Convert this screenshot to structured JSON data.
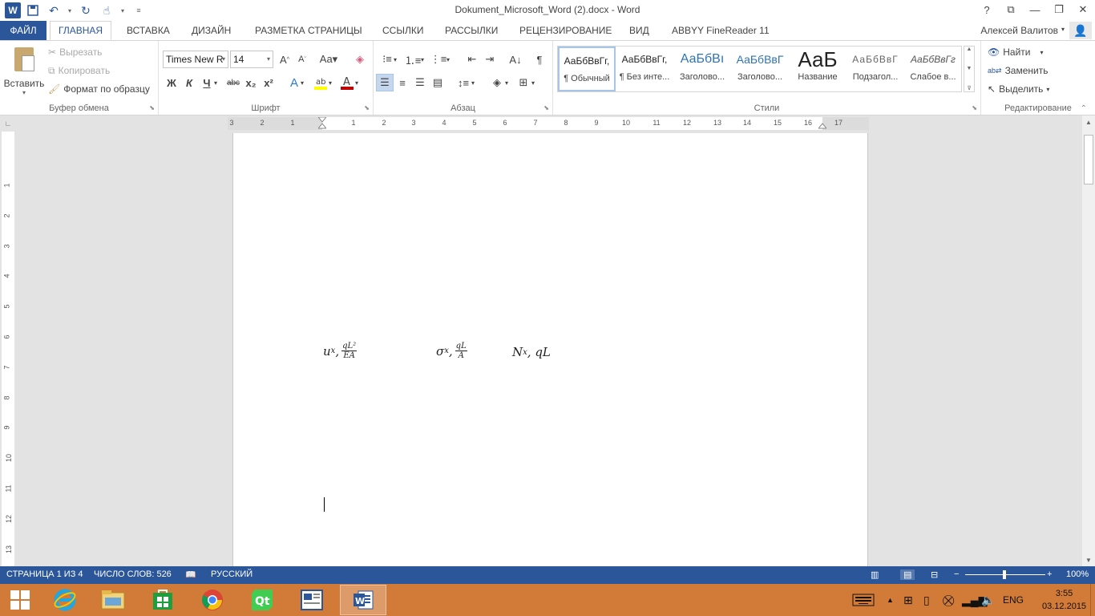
{
  "window": {
    "title": "Dokument_Microsoft_Word (2).docx - Word",
    "controls": [
      "?",
      "⧉",
      "—",
      "❐",
      "✕"
    ]
  },
  "tabs": {
    "file": "ФАЙЛ",
    "items": [
      "ГЛАВНАЯ",
      "ВСТАВКА",
      "ДИЗАЙН",
      "РАЗМЕТКА СТРАНИЦЫ",
      "ССЫЛКИ",
      "РАССЫЛКИ",
      "РЕЦЕНЗИРОВАНИЕ",
      "ВИД",
      "ABBYY FineReader 11"
    ],
    "active": "ГЛАВНАЯ"
  },
  "user": {
    "name": "Алексей Валитов"
  },
  "clipboard": {
    "label": "Буфер обмена",
    "paste": "Вставить",
    "cut": "Вырезать",
    "copy": "Копировать",
    "format_painter": "Формат по образцу"
  },
  "font": {
    "label": "Шрифт",
    "name": "Times New R",
    "size": "14",
    "buttons": [
      "Ж",
      "К",
      "Ч",
      "abc",
      "x₂",
      "x²"
    ]
  },
  "paragraph": {
    "label": "Абзац"
  },
  "styles": {
    "label": "Стили",
    "items": [
      {
        "sample": "АаБбВвГг,",
        "name": "¶ Обычный"
      },
      {
        "sample": "АаБбВвГг,",
        "name": "¶ Без инте..."
      },
      {
        "sample": "АаБбВı",
        "name": "Заголово..."
      },
      {
        "sample": "АаБбВвГ",
        "name": "Заголово..."
      },
      {
        "sample": "АаБ",
        "name": "Название"
      },
      {
        "sample": "АаБбВвГ",
        "name": "Подзагол..."
      },
      {
        "sample": "АаБбВвГг",
        "name": "Слабое в..."
      }
    ]
  },
  "editing": {
    "label": "Редактирование",
    "find": "Найти",
    "replace": "Заменить",
    "select": "Выделить"
  },
  "ruler": {
    "h_numbers": [
      "3",
      "2",
      "1",
      "1",
      "2",
      "3",
      "4",
      "5",
      "6",
      "7",
      "8",
      "9",
      "10",
      "11",
      "12",
      "13",
      "14",
      "15",
      "16",
      "17"
    ],
    "v_numbers": [
      "1",
      "2",
      "3",
      "4",
      "5",
      "6",
      "7",
      "8",
      "9",
      "10",
      "11",
      "12",
      "13"
    ]
  },
  "document": {
    "eq1": {
      "base": "u",
      "sub": "x",
      "frac_num": "qL²",
      "frac_den": "EA"
    },
    "eq2": {
      "base": "σ",
      "sub": "x",
      "frac_num": "qL",
      "frac_den": "A"
    },
    "eq3": {
      "base": "N",
      "sub": "x",
      "tail": "qL"
    }
  },
  "status": {
    "page": "СТРАНИЦА 1 ИЗ 4",
    "words": "ЧИСЛО СЛОВ: 526",
    "language": "РУССКИЙ",
    "zoom": "100%"
  },
  "taskbar": {
    "lang": "ENG",
    "time": "3:55",
    "date": "03.12.2015"
  },
  "colors": {
    "word_blue": "#2b579a",
    "taskbar": "#d27a38",
    "font_color_red": "#c00000",
    "highlight_yellow": "#ffff00"
  }
}
